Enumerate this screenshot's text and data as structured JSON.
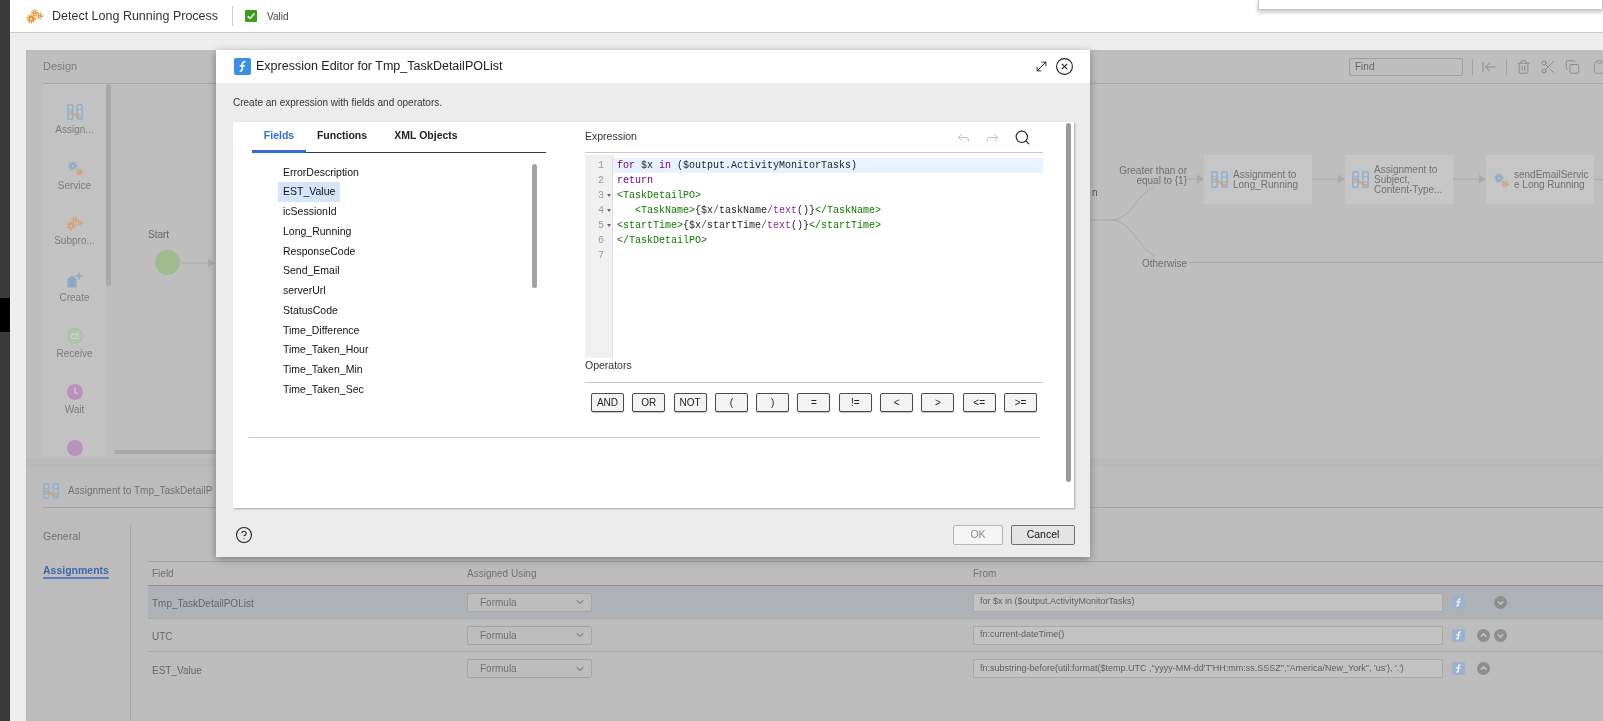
{
  "header": {
    "title": "Detect Long Running Process",
    "status": {
      "label": "Valid",
      "valid": true
    }
  },
  "design": {
    "title": "Design",
    "find": {
      "placeholder": "Find"
    },
    "palette": [
      {
        "label": "Assign...",
        "kind": "assignment"
      },
      {
        "label": "Service",
        "kind": "service"
      },
      {
        "label": "Subpro...",
        "kind": "subprocess"
      },
      {
        "label": "Create",
        "kind": "create"
      },
      {
        "label": "Receive",
        "kind": "receive"
      },
      {
        "label": "Wait",
        "kind": "wait"
      },
      {
        "kind": "circle"
      }
    ],
    "canvas": {
      "start": {
        "label": "Start"
      },
      "partial_label": "n",
      "branches": [
        {
          "label": "Greater than or equal to {1}"
        },
        {
          "label": "Otherwise"
        }
      ],
      "nodes": [
        {
          "kind": "assignment",
          "label": "Assignment to Long_Running"
        },
        {
          "kind": "assignment",
          "label": "Assignment to Subject, Content-Type..."
        },
        {
          "kind": "service",
          "label": "sendEmailService Long Running"
        }
      ]
    }
  },
  "properties": {
    "title": "Assignment to Tmp_TaskDetailP",
    "tabs": [
      {
        "label": "General",
        "selected": false
      },
      {
        "label": "Assignments",
        "selected": true
      }
    ],
    "table": {
      "columns": [
        "Field",
        "Assigned Using",
        "From"
      ],
      "rows": [
        {
          "field": "Tmp_TaskDetailPOList",
          "assigned_using": "Formula",
          "from": "for $x in ($output.ActivityMonitorTasks)",
          "selected": true,
          "can_move_up": false,
          "can_move_down": true
        },
        {
          "field": "UTC",
          "assigned_using": "Formula",
          "from": "fn:current-dateTime()",
          "selected": false,
          "can_move_up": true,
          "can_move_down": true
        },
        {
          "field": "EST_Value",
          "assigned_using": "Formula",
          "from": "fn:substring-before(util:format($temp.UTC ,\"yyyy-MM-dd'T'HH:mm:ss.SSSZ\",\"America/New_York\", 'us'), '.')",
          "selected": false,
          "can_move_up": true,
          "can_move_down": false
        }
      ]
    }
  },
  "dialog": {
    "title": "Expression Editor for Tmp_TaskDetailPOList",
    "description": "Create an expression with fields and operators.",
    "tabs": [
      {
        "label": "Fields",
        "selected": true
      },
      {
        "label": "Functions",
        "selected": false
      },
      {
        "label": "XML Objects",
        "selected": false
      }
    ],
    "fields": [
      {
        "label": "ErrorDescription",
        "selected": false
      },
      {
        "label": "EST_Value",
        "selected": true
      },
      {
        "label": "icSessionId",
        "selected": false
      },
      {
        "label": "Long_Running",
        "selected": false
      },
      {
        "label": "ResponseCode",
        "selected": false
      },
      {
        "label": "Send_Email",
        "selected": false
      },
      {
        "label": "serverUrl",
        "selected": false
      },
      {
        "label": "StatusCode",
        "selected": false
      },
      {
        "label": "Time_Difference",
        "selected": false
      },
      {
        "label": "Time_Taken_Hour",
        "selected": false
      },
      {
        "label": "Time_Taken_Min",
        "selected": false
      },
      {
        "label": "Time_Taken_Sec",
        "selected": false
      }
    ],
    "expression": {
      "label": "Expression",
      "actions": [
        {
          "kind": "undo",
          "disabled": true
        },
        {
          "kind": "redo",
          "disabled": true
        },
        {
          "kind": "search",
          "disabled": false
        }
      ],
      "lines": [
        {
          "number": "1",
          "active": true,
          "fold_marker": false,
          "tokens": [
            {
              "kind": "keyword",
              "text": "for"
            },
            {
              "kind": "plain",
              "text": " $x "
            },
            {
              "kind": "keyword",
              "text": "in"
            },
            {
              "kind": "plain",
              "text": " ($output.ActivityMonitorTasks)"
            }
          ]
        },
        {
          "number": "2",
          "active": false,
          "fold_marker": false,
          "tokens": [
            {
              "kind": "keyword",
              "text": "return"
            }
          ]
        },
        {
          "number": "3",
          "active": false,
          "fold_marker": true,
          "tokens": [
            {
              "kind": "tag",
              "text": "<TaskDetailPO>"
            }
          ]
        },
        {
          "number": "4",
          "active": false,
          "fold_marker": true,
          "tokens": [
            {
              "kind": "tag",
              "text": "   <TaskName>"
            },
            {
              "kind": "plain",
              "text": "{$x"
            },
            {
              "kind": "operator",
              "text": "/"
            },
            {
              "kind": "plain",
              "text": "taskName"
            },
            {
              "kind": "operator",
              "text": "/"
            },
            {
              "kind": "operator",
              "text": "text"
            },
            {
              "kind": "plain",
              "text": "()}"
            },
            {
              "kind": "tag",
              "text": "</TaskName>"
            }
          ]
        },
        {
          "number": "5",
          "active": false,
          "fold_marker": true,
          "tokens": [
            {
              "kind": "tag",
              "text": "<startTime>"
            },
            {
              "kind": "plain",
              "text": "{$x"
            },
            {
              "kind": "operator",
              "text": "/"
            },
            {
              "kind": "plain",
              "text": "startTime"
            },
            {
              "kind": "operator",
              "text": "/"
            },
            {
              "kind": "operator",
              "text": "text"
            },
            {
              "kind": "plain",
              "text": "()}"
            },
            {
              "kind": "tag",
              "text": "</startTime>"
            }
          ]
        },
        {
          "number": "6",
          "active": false,
          "fold_marker": false,
          "tokens": [
            {
              "kind": "tag",
              "text": "</TaskDetailPO>"
            }
          ]
        },
        {
          "number": "7",
          "active": false,
          "fold_marker": false
        }
      ]
    },
    "operators": {
      "label": "Operators",
      "items": [
        "AND",
        "OR",
        "NOT",
        "(",
        ")",
        "=",
        "!=",
        "<",
        ">",
        "<=",
        ">="
      ]
    },
    "buttons": [
      {
        "label": "OK",
        "disabled": true
      },
      {
        "label": "Cancel",
        "disabled": false
      }
    ]
  }
}
